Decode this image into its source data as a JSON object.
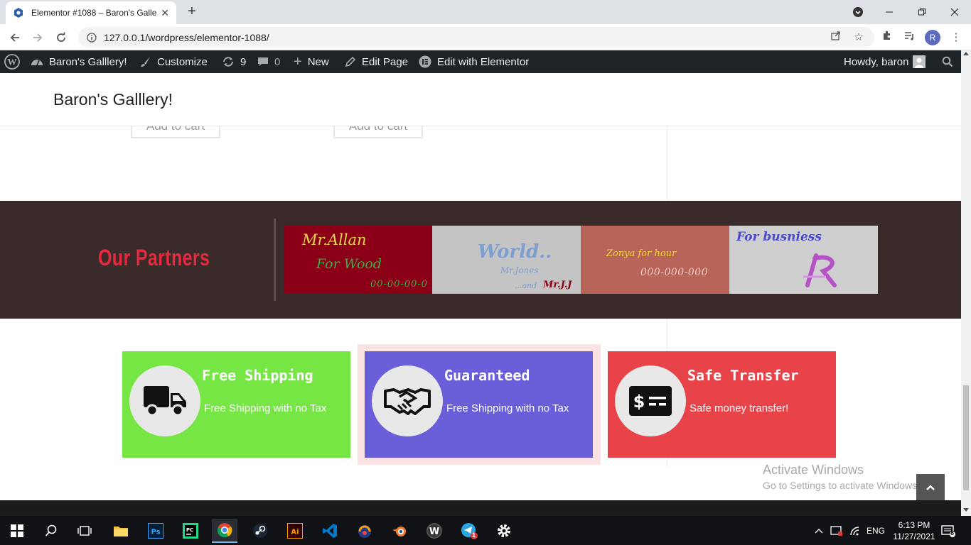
{
  "browser": {
    "tab_title": "Elementor #1088 – Baron's Galle",
    "tab_close": "✕",
    "new_tab": "+",
    "url": "127.0.0.1/wordpress/elementor-1088/",
    "profile_initial": "R"
  },
  "admin_bar": {
    "site_name": "Baron's Galllery!",
    "customize": "Customize",
    "updates_count": "9",
    "comments_count": "0",
    "new": "New",
    "edit_page": "Edit Page",
    "edit_elementor": "Edit with Elementor",
    "howdy": "Howdy, baron"
  },
  "site": {
    "title": "Baron's Galllery!",
    "add_to_cart": "Add to cart"
  },
  "partners": {
    "heading": "Our Partners",
    "logos": [
      {
        "lines": [
          "Mr.Allan",
          "For Wood",
          "00-00-00-0"
        ],
        "bg": "#8b0016"
      },
      {
        "lines": [
          "World..",
          "Mr.Jones",
          "...and",
          "Mr.J.J"
        ],
        "bg": "#c4c4c4"
      },
      {
        "lines": [
          "Zonya for hour",
          "000-000-000"
        ],
        "bg": "#b86459"
      },
      {
        "lines": [
          "For busniess"
        ],
        "bg": "#cfcfcf"
      }
    ]
  },
  "features": [
    {
      "title": "Free Shipping",
      "desc": "Free Shipping with no Tax",
      "icon": "truck-icon",
      "color": "#76e645"
    },
    {
      "title": "Guaranteed",
      "desc": "Free Shipping with no Tax",
      "icon": "handshake-icon",
      "color": "#6b5fd9"
    },
    {
      "title": "Safe Transfer",
      "desc": "Safe money transfer!",
      "icon": "money-icon",
      "color": "#e9434a"
    }
  ],
  "watermark": {
    "line1": "Activate Windows",
    "line2": "Go to Settings to activate Windows."
  },
  "taskbar": {
    "language": "ENG",
    "time": "6:13 PM",
    "date": "11/27/2021",
    "notification_count": "8",
    "telegram_badge": "1"
  }
}
